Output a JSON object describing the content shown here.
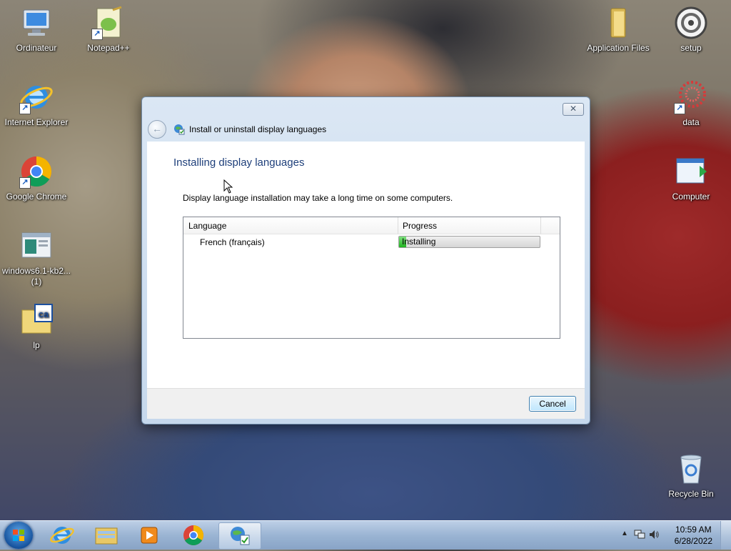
{
  "desktop": {
    "icons_left": [
      {
        "label": "Ordinateur",
        "icon": "computer-icon"
      },
      {
        "label": "Notepad++",
        "icon": "notepadpp-icon"
      },
      {
        "label": "Internet Explorer",
        "icon": "ie-icon"
      },
      {
        "label": "Google Chrome",
        "icon": "chrome-icon"
      },
      {
        "label": "windows6.1-kb2...",
        "label2": "(1)",
        "icon": "msu-file-icon"
      },
      {
        "label": "lp",
        "icon": "cab-file-icon"
      }
    ],
    "icons_right": [
      {
        "label": "Application Files",
        "icon": "folder-icon"
      },
      {
        "label": "setup",
        "icon": "setup-disc-icon"
      },
      {
        "label": "data",
        "icon": "data-icon"
      },
      {
        "label": "Computer",
        "icon": "computer-app-icon"
      },
      {
        "label": "Recycle Bin",
        "icon": "recycle-bin-icon"
      }
    ]
  },
  "dialog": {
    "title": "Install or uninstall display languages",
    "close_glyph": "✕",
    "heading": "Installing display languages",
    "description": "Display language installation may take a long time on some computers.",
    "columns": {
      "language": "Language",
      "progress": "Progress"
    },
    "rows": [
      {
        "language": "French (français)",
        "status": "Installing",
        "progress": 0.05
      }
    ],
    "cancel_label": "Cancel"
  },
  "taskbar": {
    "clock_time": "10:59 AM",
    "clock_date": "6/28/2022"
  },
  "colors": {
    "heading": "#1e3f7a",
    "progress_fill": "#1fb31f",
    "taskbar": "#a0badb"
  }
}
